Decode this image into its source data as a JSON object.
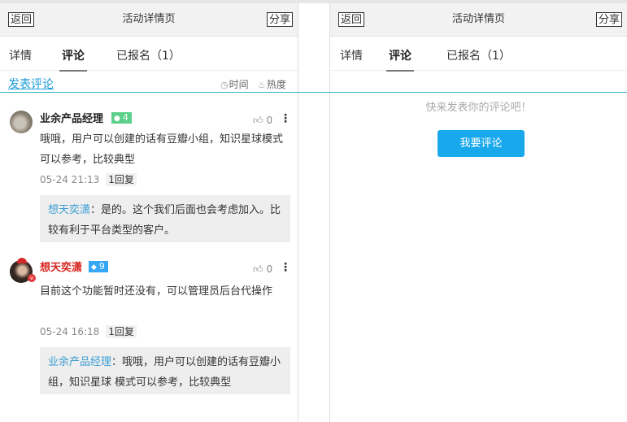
{
  "header": {
    "back": "返回",
    "title": "活动详情页",
    "share": "分享"
  },
  "tabs": [
    {
      "label": "详情"
    },
    {
      "label": "评论"
    },
    {
      "label": "已报名（1）"
    }
  ],
  "bar": {
    "post_comment": "发表评论",
    "sort_time": "时间",
    "sort_hot": "热度"
  },
  "comments": [
    {
      "user": "业余产品经理",
      "level": "4",
      "likes": "0",
      "text": "哦哦，用户可以创建的话有豆瓣小组，知识星球模式可以参考，比较典型",
      "time": "05-24 21:13",
      "replies": "1回复",
      "reply": {
        "who": "想天奕潇",
        "text": "：是的。这个我们后面也会考虑加入。比较有利于平台类型的客户。"
      }
    },
    {
      "user": "想天奕潇",
      "level": "9",
      "likes": "0",
      "text": "目前这个功能暂时还没有，可以管理员后台代操作",
      "time": "05-24 16:18",
      "replies": "1回复",
      "reply": {
        "who": "业余产品经理",
        "text": "：哦哦，用户可以创建的话有豆瓣小组，知识星球 模式可以参考，比较典型"
      }
    }
  ],
  "right": {
    "empty_text": "快来发表你的评论吧！",
    "cta": "我要评论"
  },
  "colors": {
    "accent": "#18a8ec",
    "link": "#1a9bd8",
    "level_green": "#5cd08a",
    "level_blue": "#35a7f5",
    "vip_red": "#d7261f"
  }
}
